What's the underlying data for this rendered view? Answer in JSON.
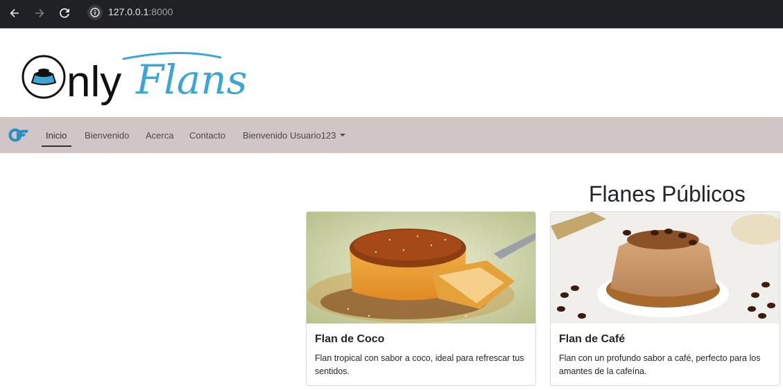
{
  "browser": {
    "url_host": "127.0.0.1",
    "url_port": ":8000"
  },
  "logo": {
    "part1": "Only",
    "part2": "Flans"
  },
  "navbar": {
    "items": [
      {
        "label": "Inicio",
        "active": true
      },
      {
        "label": "Bienvenido"
      },
      {
        "label": "Acerca"
      },
      {
        "label": "Contacto"
      },
      {
        "label": "Bienvenido Usuario123",
        "dropdown": true
      }
    ]
  },
  "main": {
    "title": "Flanes Públicos",
    "cards": [
      {
        "title": "Flan de Coco",
        "description": "Flan tropical con sabor a coco, ideal para refrescar tus sentidos."
      },
      {
        "title": "Flan de Café",
        "description": "Flan con un profundo sabor a café, perfecto para los amantes de la cafeína."
      }
    ]
  },
  "colors": {
    "navbar_bg": "#d2c5c5",
    "brand_blue": "#3aa5d6",
    "chrome_bg": "#202124"
  }
}
